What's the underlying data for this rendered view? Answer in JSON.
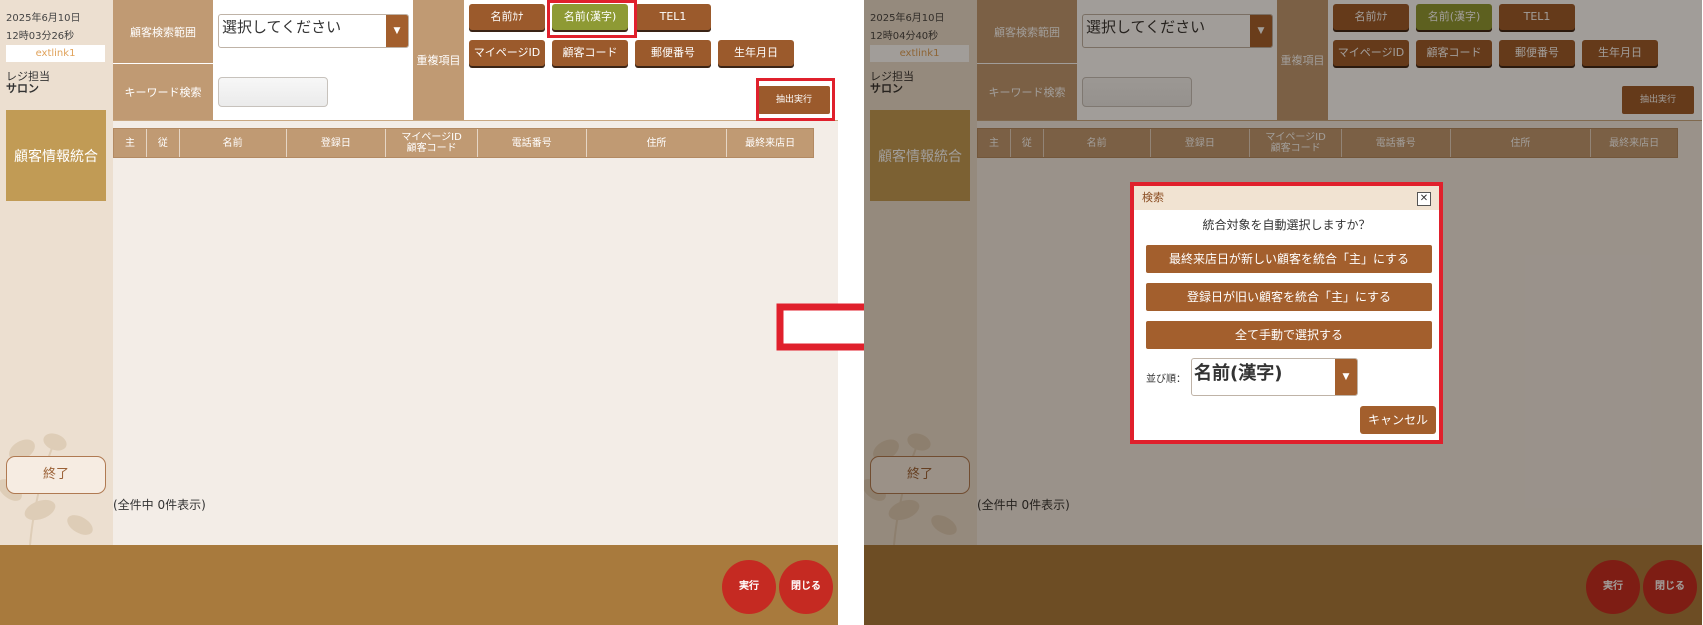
{
  "screens": [
    {
      "date": "2025年6月10日",
      "time": "12時03分26秒",
      "user": "extlink1",
      "reji_label": "レジ担当",
      "reji_name": "サロン",
      "side_title": "顧客情報統合",
      "end_label": "終了",
      "search_range_label": "顧客検索範囲",
      "search_range_value": "選択してください",
      "keyword_label": "キーワード検索",
      "dup_label": "重複項目",
      "dup_buttons": [
        "名前ｶﾅ",
        "名前(漢字)",
        "TEL1",
        "マイページID",
        "顧客コード",
        "郵便番号",
        "生年月日"
      ],
      "active_dup": "名前(漢字)",
      "extract_label": "抽出実行",
      "columns": [
        "主",
        "従",
        "名前",
        "登録日",
        "マイページID\n顧客コード",
        "電話番号",
        "住所",
        "最終来店日"
      ],
      "count_text": "(全件中 0件表示)",
      "run_label": "実行",
      "close_label": "閉じる"
    },
    {
      "date": "2025年6月10日",
      "time": "12時04分40秒",
      "user": "extlink1",
      "reji_label": "レジ担当",
      "reji_name": "サロン",
      "side_title": "顧客情報統合",
      "end_label": "終了",
      "search_range_label": "顧客検索範囲",
      "search_range_value": "選択してください",
      "keyword_label": "キーワード検索",
      "dup_label": "重複項目",
      "dup_buttons": [
        "名前ｶﾅ",
        "名前(漢字)",
        "TEL1",
        "マイページID",
        "顧客コード",
        "郵便番号",
        "生年月日"
      ],
      "active_dup": "名前(漢字)",
      "extract_label": "抽出実行",
      "columns": [
        "主",
        "従",
        "名前",
        "登録日",
        "マイページID\n顧客コード",
        "電話番号",
        "住所",
        "最終来店日"
      ],
      "count_text": "(全件中 0件表示)",
      "run_label": "実行",
      "close_label": "閉じる"
    }
  ],
  "dialog": {
    "title": "検索",
    "close_glyph": "✕",
    "question": "統合対象を自動選択しますか？",
    "options": [
      "最終来店日が新しい顧客を統合「主」にする",
      "登録日が旧い顧客を統合「主」にする",
      "全て手動で選択する"
    ],
    "sort_label": "並び順：",
    "sort_value": "名前(漢字)",
    "cancel_label": "キャンセル"
  },
  "colors": {
    "accent": "#a35f2d",
    "active_button": "#8e9a34",
    "highlight": "#e0202c",
    "footer": "#a87a3d",
    "circle_button": "#c52a22"
  },
  "icons": [
    "dropdown-arrow-icon",
    "close-icon",
    "arrow-right-icon",
    "plant-decoration-icon"
  ]
}
